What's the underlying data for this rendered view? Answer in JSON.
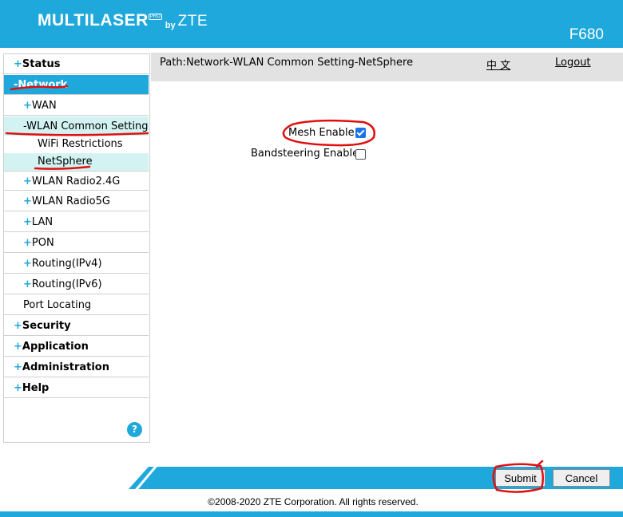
{
  "header": {
    "brand": "MULTILASER",
    "brand_tag": "PRO",
    "brand_by": "by",
    "brand_zte": "ZTE",
    "model": "F680"
  },
  "sidebar": {
    "items": [
      {
        "sign": "+",
        "label": "Status"
      },
      {
        "sign": "-",
        "label": "Network"
      },
      {
        "sign": "+",
        "label": "WAN"
      },
      {
        "sign": "-",
        "label": "WLAN Common Setting"
      },
      {
        "sign": "",
        "label": "WiFi Restrictions"
      },
      {
        "sign": "",
        "label": "NetSphere"
      },
      {
        "sign": "+",
        "label": "WLAN Radio2.4G"
      },
      {
        "sign": "+",
        "label": "WLAN Radio5G"
      },
      {
        "sign": "+",
        "label": "LAN"
      },
      {
        "sign": "+",
        "label": "PON"
      },
      {
        "sign": "+",
        "label": "Routing(IPv4)"
      },
      {
        "sign": "+",
        "label": "Routing(IPv6)"
      },
      {
        "sign": "",
        "label": "Port Locating"
      },
      {
        "sign": "+",
        "label": "Security"
      },
      {
        "sign": "+",
        "label": "Application"
      },
      {
        "sign": "+",
        "label": "Administration"
      },
      {
        "sign": "+",
        "label": "Help"
      }
    ],
    "help_icon": "?"
  },
  "topbar": {
    "path": "Path:Network-WLAN Common Setting-NetSphere",
    "language": "中 文",
    "logout": "Logout"
  },
  "form": {
    "mesh_label": "Mesh Enable",
    "mesh_checked": true,
    "bandsteering_label": "Bandsteering Enable",
    "bandsteering_checked": false
  },
  "buttons": {
    "submit": "Submit",
    "cancel": "Cancel"
  },
  "footer": {
    "copyright": "©2008-2020 ZTE Corporation. All rights reserved."
  },
  "colors": {
    "accent": "#1fa8db",
    "selected_bg": "#d3f3f3",
    "annotation": "#e01010"
  }
}
